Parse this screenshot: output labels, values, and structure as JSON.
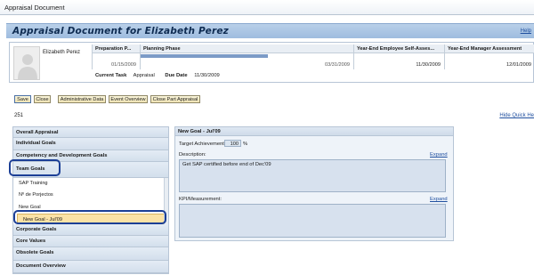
{
  "window": {
    "title": "Appraisal Document"
  },
  "header": {
    "title": "Appraisal Document for Elizabeth Perez",
    "help_link": "Help"
  },
  "employee": {
    "name": "Elizabeth Perez"
  },
  "phases": [
    {
      "label": "Preparation P...",
      "date": "01/15/2009"
    },
    {
      "label": "Planning Phase",
      "date": "03/31/2009"
    },
    {
      "label": "Year-End Employee Self-Asses...",
      "date": "11/30/2009"
    },
    {
      "label": "Year-End Manager Assessment",
      "date": "12/01/2009"
    }
  ],
  "planning_progress": 0.6,
  "current_task": {
    "label": "Current Task",
    "value": "Appraisal",
    "due_label": "Due Date",
    "due_value": "11/30/2009"
  },
  "toolbar": {
    "save": "Save",
    "close": "Close",
    "admin_data": "Administrative Data",
    "event_overview": "Event Overview",
    "close_part": "Close Part Appraisal"
  },
  "counter": "251",
  "hide_quick_help": "Hide Quick He",
  "nav": {
    "overall": "Overall Appraisal",
    "individual": "Individual Goals",
    "competency": "Competency and Development Goals",
    "team": "Team Goals",
    "team_items": [
      "SAP Training",
      "Nº de Porjectos",
      "New Goal",
      "New Goal - Jul'09"
    ],
    "corporate": "Corporate Goals",
    "core_values": "Core Values",
    "obsolete": "Obsolete Goals",
    "document_overview": "Document Overview"
  },
  "detail": {
    "title": "New Goal - Jul'09",
    "target_label": "Target Achievement:",
    "target_value": "100",
    "target_unit": "%",
    "description_label": "Description:",
    "description_expand": "Expand",
    "description_text": "Get SAP certified before end of Dec'09",
    "kpi_label": "KPI/Measurement:",
    "kpi_expand": "Expand",
    "kpi_text": ""
  }
}
